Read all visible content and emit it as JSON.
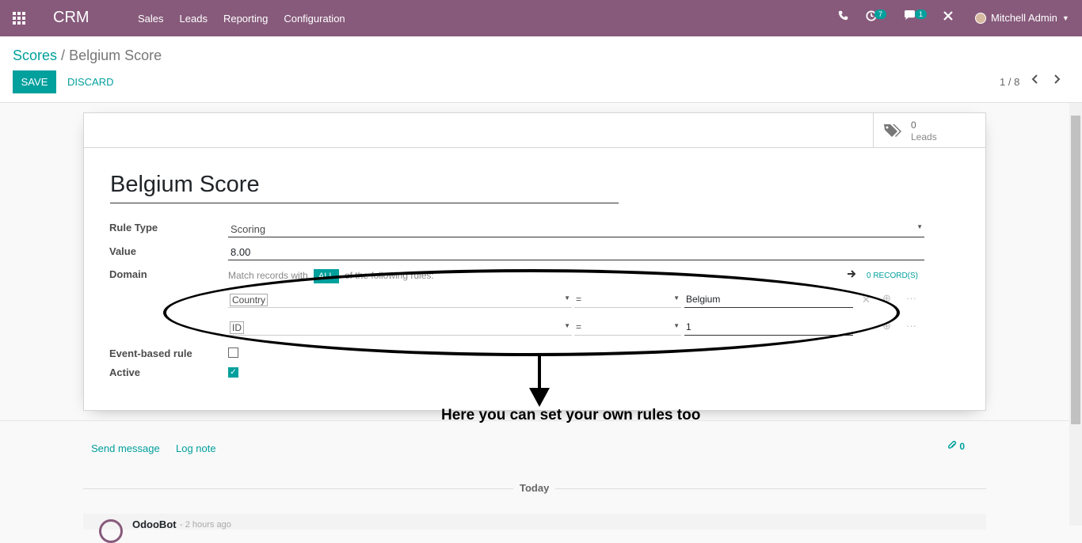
{
  "navbar": {
    "app_title": "CRM",
    "menu": [
      "Sales",
      "Leads",
      "Reporting",
      "Configuration"
    ],
    "activity_count": "7",
    "message_count": "1",
    "user_name": "Mitchell Admin",
    "color": "#875a7b"
  },
  "control_panel": {
    "breadcrumb_parent": "Scores",
    "breadcrumb_sep": "/",
    "breadcrumb_current": "Belgium Score",
    "save_label": "SAVE",
    "discard_label": "DISCARD",
    "pager": "1 / 8",
    "accent": "#00a09d"
  },
  "form": {
    "stat_value": "0",
    "stat_label": "Leads",
    "name": "Belgium Score",
    "rule_type_label": "Rule Type",
    "rule_type_value": "Scoring",
    "value_label": "Value",
    "value_value": "8.00",
    "domain_label": "Domain",
    "domain_match_prefix": "Match records with",
    "domain_all": "ALL",
    "domain_match_suffix": "of the following rules:",
    "records_link": "0 RECORD(S)",
    "rules": [
      {
        "field": "Country",
        "operator": "=",
        "value": "Belgium"
      },
      {
        "field": "ID",
        "operator": "=",
        "value": "1"
      }
    ],
    "event_based_label": "Event-based rule",
    "event_based_checked": false,
    "active_label": "Active",
    "active_checked": true
  },
  "annotation": {
    "text": "Here you can set your own rules too"
  },
  "chatter": {
    "send_message": "Send message",
    "log_note": "Log note",
    "attachment_count": "0",
    "date_separator": "Today",
    "message_author": "OdooBot",
    "message_date": "- 2 hours ago"
  },
  "icons": [
    "apps-grid-icon",
    "phone-icon",
    "activity-clock-icon",
    "chat-icon",
    "close-x-icon",
    "tag-icon",
    "arrow-right-icon",
    "chevron-left-icon",
    "chevron-right-icon",
    "paperclip-icon"
  ]
}
